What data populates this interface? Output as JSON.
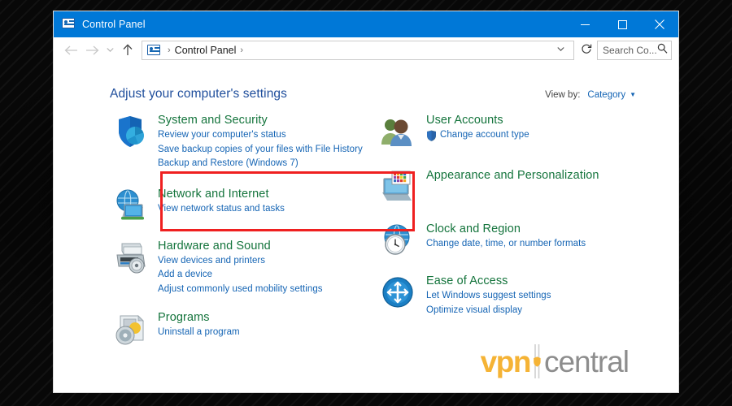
{
  "window": {
    "title": "Control Panel",
    "icon": "control-panel-icon",
    "controls": {
      "minimize": "minimize-icon",
      "maximize": "maximize-icon",
      "close": "close-icon"
    }
  },
  "navbar": {
    "back": "back-arrow-icon",
    "forward": "forward-arrow-icon",
    "recent": "history-chevron-icon",
    "up": "up-arrow-icon",
    "breadcrumb_icon": "control-panel-icon",
    "breadcrumb": "Control Panel",
    "separator": "›",
    "dropdown": "chevron-down-icon",
    "refresh": "refresh-icon",
    "search_placeholder": "Search Co...",
    "search_value": "",
    "search_icon": "search-icon"
  },
  "header": {
    "page_title": "Adjust your computer's settings",
    "view_by_label": "View by:",
    "view_by_value": "Category"
  },
  "categories_left": [
    {
      "icon": "shield-security-icon",
      "title": "System and Security",
      "links": [
        "Review your computer's status",
        "Save backup copies of your files with File History",
        "Backup and Restore (Windows 7)"
      ]
    },
    {
      "icon": "globe-network-icon",
      "title": "Network and Internet",
      "links": [
        "View network status and tasks"
      ]
    },
    {
      "icon": "printer-hardware-icon",
      "title": "Hardware and Sound",
      "links": [
        "View devices and printers",
        "Add a device",
        "Adjust commonly used mobility settings"
      ]
    },
    {
      "icon": "programs-disc-icon",
      "title": "Programs",
      "links": [
        "Uninstall a program"
      ]
    }
  ],
  "categories_right": [
    {
      "icon": "user-accounts-icon",
      "title": "User Accounts",
      "links": [
        "Change account type"
      ],
      "link_shield": true
    },
    {
      "icon": "appearance-icon",
      "title": "Appearance and Personalization",
      "links": []
    },
    {
      "icon": "clock-region-icon",
      "title": "Clock and Region",
      "links": [
        "Change date, time, or number formats"
      ]
    },
    {
      "icon": "ease-of-access-icon",
      "title": "Ease of Access",
      "links": [
        "Let Windows suggest settings",
        "Optimize visual display"
      ]
    }
  ],
  "annotation": {
    "highlight_target": "System and Security",
    "highlight_color": "#ef2020"
  },
  "watermark": {
    "part1": "vpn",
    "part2": "central",
    "part1_color": "#f5b335",
    "part2_color": "#8d8d8d"
  }
}
